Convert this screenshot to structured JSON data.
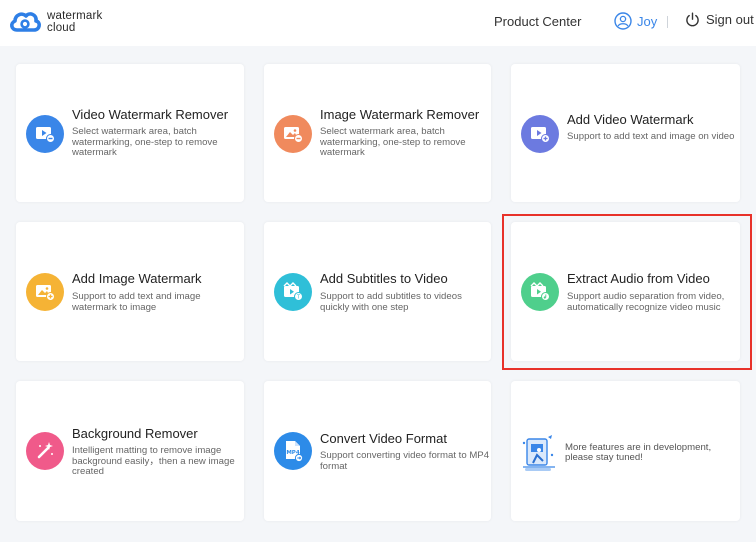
{
  "header": {
    "logo_line1": "watermark",
    "logo_line2": "cloud",
    "product_center": "Product Center",
    "user_name": "Joy",
    "sign_out": "Sign out",
    "accent_color": "#3a86e8"
  },
  "cards": [
    {
      "title": "Video Watermark Remover",
      "desc": "Select watermark area, batch watermarking, one-step to remove watermark",
      "icon": "video-remove-icon",
      "color": "#3a86e8"
    },
    {
      "title": "Image Watermark Remover",
      "desc": "Select watermark area, batch watermarking, one-step to remove watermark",
      "icon": "image-remove-icon",
      "color": "#f08a5d"
    },
    {
      "title": "Add Video Watermark",
      "desc": "Support to add text and image on video",
      "icon": "video-add-icon",
      "color": "#6c7ae0"
    },
    {
      "title": "Add Image Watermark",
      "desc": "Support to add text and image watermark to image",
      "icon": "image-add-icon",
      "color": "#f5b335"
    },
    {
      "title": "Add Subtitles to Video",
      "desc": "Support to add subtitles to videos quickly with one step",
      "icon": "subtitle-icon",
      "color": "#2fbfd8"
    },
    {
      "title": "Extract Audio from Video",
      "desc": "Support audio separation from video, automatically recognize video music",
      "icon": "audio-extract-icon",
      "color": "#4fcf8c"
    },
    {
      "title": "Background Remover",
      "desc": "Intelligent matting to remove image background easily，then a new image created",
      "icon": "magic-wand-icon",
      "color": "#f05a8a"
    },
    {
      "title": "Convert Video Format",
      "desc": "Support converting video format to MP4 format",
      "icon": "mp4-file-icon",
      "color": "#2d8be8",
      "badge": "MP4"
    }
  ],
  "more": {
    "desc": "More features are in development, please stay tuned!",
    "icon": "development-illustration-icon"
  }
}
